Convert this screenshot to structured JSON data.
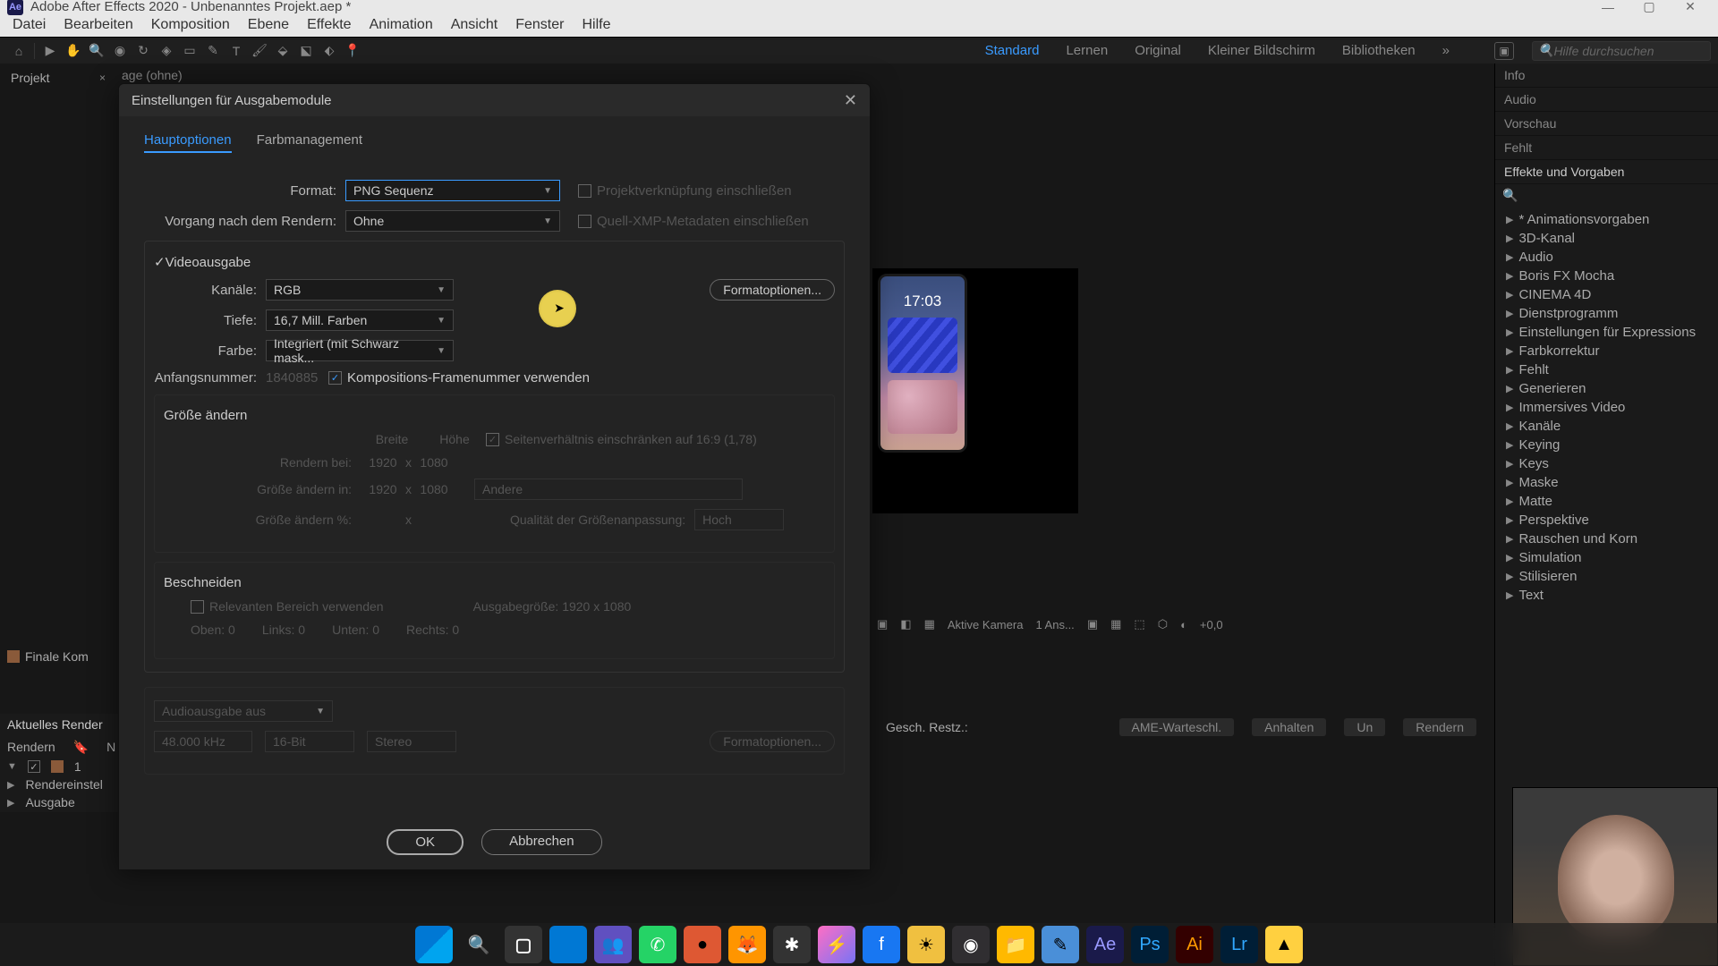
{
  "titlebar": {
    "app_badge": "Ae",
    "title": "Adobe After Effects 2020 - Unbenanntes Projekt.aep *"
  },
  "menubar": [
    "Datei",
    "Bearbeiten",
    "Komposition",
    "Ebene",
    "Effekte",
    "Animation",
    "Ansicht",
    "Fenster",
    "Hilfe"
  ],
  "workspaces": {
    "items": [
      "Standard",
      "Lernen",
      "Original",
      "Kleiner Bildschirm",
      "Bibliotheken"
    ],
    "active": "Standard",
    "search_placeholder": "Hilfe durchsuchen"
  },
  "left_panel": {
    "tab": "Projekt"
  },
  "comp_tab": "age (ohne)",
  "phone_time": "17:03",
  "viewer_controls": {
    "camera": "Aktive Kamera",
    "views": "1 Ans...",
    "exposure": "+0,0"
  },
  "right_panels": {
    "info": "Info",
    "audio": "Audio",
    "preview": "Vorschau",
    "missing": "Fehlt",
    "effects_title": "Effekte und Vorgaben"
  },
  "effects": [
    "* Animationsvorgaben",
    "3D-Kanal",
    "Audio",
    "Boris FX Mocha",
    "CINEMA 4D",
    "Dienstprogramm",
    "Einstellungen für Expressions",
    "Farbkorrektur",
    "Fehlt",
    "Generieren",
    "Immersives Video",
    "Kanäle",
    "Keying",
    "Keys",
    "Maske",
    "Matte",
    "Perspektive",
    "Rauschen und Korn",
    "Simulation",
    "Stilisieren",
    "Text"
  ],
  "bottom_left": "Finale Kom",
  "render_queue": {
    "tab": "Aktuelles Render",
    "cols": {
      "render": "Rendern",
      "n": "N"
    },
    "row_num": "1",
    "render_settings": "Rendereinstel",
    "output_module": "Ausgabe"
  },
  "render_status": {
    "label": "Gesch. Restz.:",
    "btns": [
      "AME-Warteschl.",
      "Anhalten",
      "Un",
      "Rendern"
    ]
  },
  "dialog": {
    "title": "Einstellungen für Ausgabemodule",
    "tabs": {
      "main": "Hauptoptionen",
      "color": "Farbmanagement"
    },
    "format_label": "Format:",
    "format_value": "PNG Sequenz",
    "project_link": "Projektverknüpfung einschließen",
    "post_render_label": "Vorgang nach dem Rendern:",
    "post_render_value": "Ohne",
    "xmp": "Quell-XMP-Metadaten einschließen",
    "video_output": "Videoausgabe",
    "channels_label": "Kanäle:",
    "channels_value": "RGB",
    "format_options_btn": "Formatoptionen...",
    "depth_label": "Tiefe:",
    "depth_value": "16,7 Mill. Farben",
    "color_label": "Farbe:",
    "color_value": "Integriert (mit Schwarz mask...",
    "start_num_label": "Anfangsnummer:",
    "start_num_value": "1840885",
    "use_comp_frame": "Kompositions-Framenummer verwenden",
    "resize": "Größe ändern",
    "width": "Breite",
    "height": "Höhe",
    "lock_aspect": "Seitenverhältnis einschränken auf 16:9 (1,78)",
    "render_at": "Rendern bei:",
    "render_at_w": "1920",
    "render_at_h": "1080",
    "resize_to": "Größe ändern in:",
    "resize_to_w": "1920",
    "resize_to_h": "1080",
    "resize_type": "Andere",
    "resize_pct": "Größe ändern %:",
    "resize_quality": "Qualität der Größenanpassung:",
    "resize_quality_val": "Hoch",
    "crop": "Beschneiden",
    "crop_roi": "Relevanten Bereich verwenden",
    "crop_output": "Ausgabegröße: 1920 x 1080",
    "crop_top": "Oben:",
    "crop_top_v": "0",
    "crop_left": "Links:",
    "crop_left_v": "0",
    "crop_bottom": "Unten:",
    "crop_bottom_v": "0",
    "crop_right": "Rechts:",
    "crop_right_v": "0",
    "audio_out": "Audioausgabe aus",
    "audio_hz": "48.000 kHz",
    "audio_bit": "16-Bit",
    "audio_ch": "Stereo",
    "audio_fmt_btn": "Formatoptionen...",
    "ok": "OK",
    "cancel": "Abbrechen"
  }
}
